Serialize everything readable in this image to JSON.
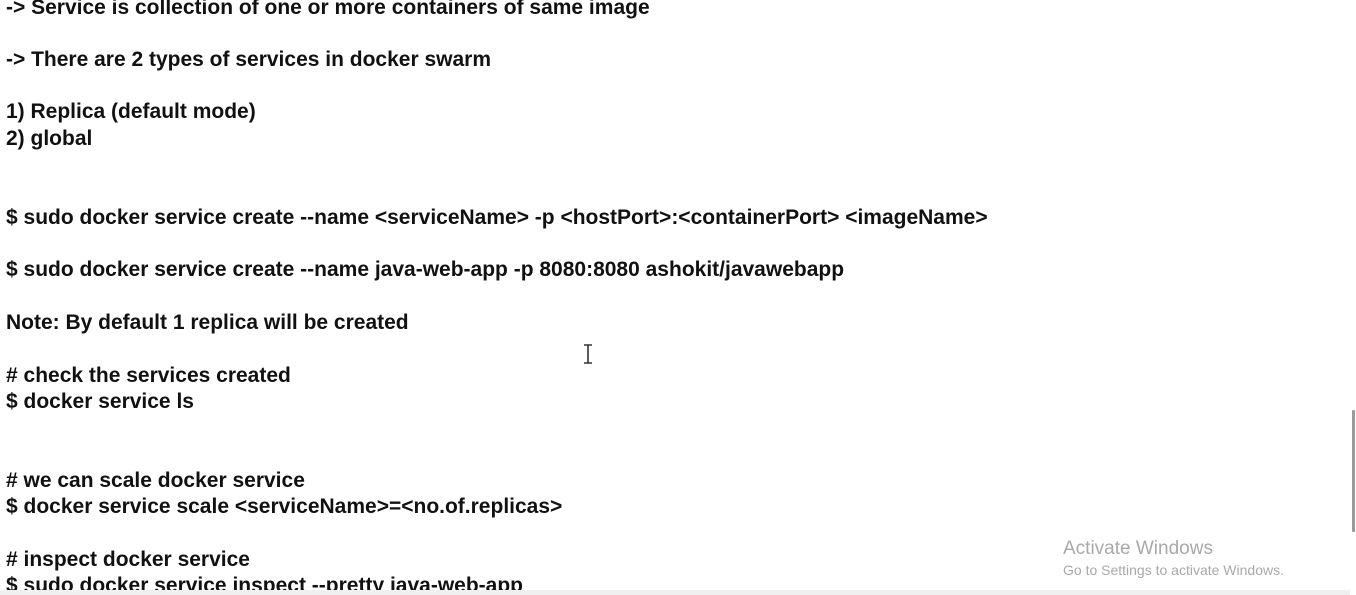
{
  "document": {
    "lines": [
      "-> Service is collection of one or more containers of same image",
      "-> There are 2 types of services in docker swarm",
      "1) Replica (default mode)",
      "2) global",
      "$ sudo docker service create --name <serviceName> -p <hostPort>:<containerPort> <imageName>",
      "$ sudo docker service create --name java-web-app -p 8080:8080 ashokit/javawebapp",
      "Note: By default 1 replica will be created",
      "# check the services created",
      "$ docker service ls",
      "# we can scale docker service",
      "$ docker service scale <serviceName>=<no.of.replicas>",
      "# inspect docker service",
      "$ sudo docker service inspect --pretty java-web-app"
    ]
  },
  "watermark": {
    "title": "Activate Windows",
    "subtitle": "Go to Settings to activate Windows."
  },
  "scrollbar": {
    "position_fraction": 0.69
  },
  "cursor": {
    "icon": "text-cursor-icon"
  }
}
